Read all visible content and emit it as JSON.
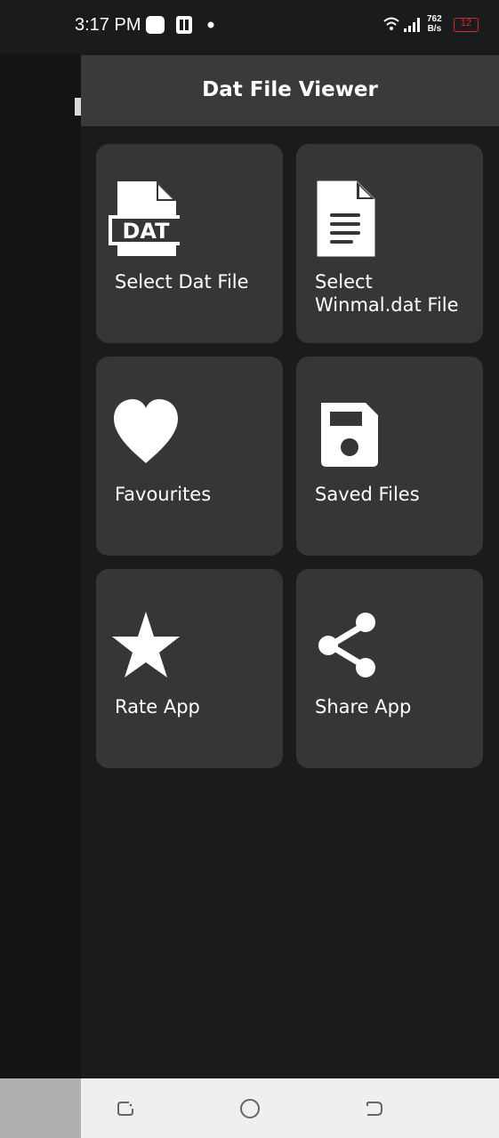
{
  "status_bar": {
    "time": "3:17 PM",
    "net_speed": "762",
    "net_unit": "B/s",
    "battery": "12"
  },
  "toolbar": {
    "title": "Dat File Viewer"
  },
  "menu": [
    {
      "label": "Select Dat File",
      "icon": "dat-file-icon"
    },
    {
      "label": "Select Winmal.dat File",
      "icon": "document-icon"
    },
    {
      "label": "Favourites",
      "icon": "heart-icon"
    },
    {
      "label": "Saved Files",
      "icon": "floppy-disk-icon"
    },
    {
      "label": "Rate App",
      "icon": "star-icon"
    },
    {
      "label": "Share App",
      "icon": "share-icon"
    }
  ],
  "colors": {
    "background": "#1a1b1d",
    "card": "#363638",
    "toolbar": "#3a3a3c",
    "battery_low": "#d32f2f"
  }
}
